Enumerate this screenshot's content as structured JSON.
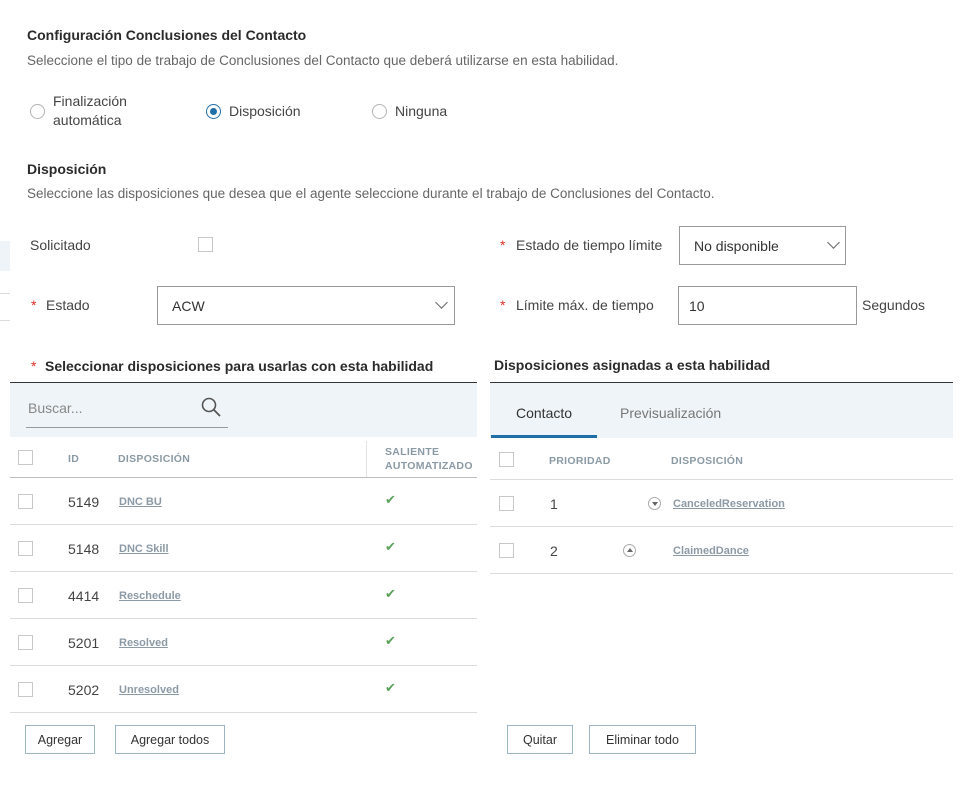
{
  "acw": {
    "title": "Configuración Conclusiones del Contacto",
    "description": "Seleccione el tipo de trabajo de Conclusiones del Contacto que deberá utilizarse en esta habilidad.",
    "options": [
      {
        "line1": "Finalización",
        "line2": "automática",
        "checked": false
      },
      {
        "label": "Disposición",
        "checked": true
      },
      {
        "label": "Ninguna",
        "checked": false
      }
    ]
  },
  "disposition": {
    "title": "Disposición",
    "description": "Seleccione las disposiciones que desea que el agente seleccione durante el trabajo de Conclusiones del Contacto."
  },
  "form": {
    "required_mark": "*",
    "solicitado_label": "Solicitado",
    "timeout_state_label": "Estado de tiempo límite",
    "timeout_state_value": "No disponible",
    "estado_label": "Estado",
    "estado_value": "ACW",
    "max_time_label": "Límite máx. de tiempo",
    "max_time_value": "10",
    "max_time_unit": "Segundos"
  },
  "available": {
    "title": "Seleccionar disposiciones para usarlas con esta habilidad",
    "search_placeholder": "Buscar...",
    "columns": {
      "id": "ID",
      "disposition": "DISPOSICIÓN",
      "outbound_line1": "SALIENTE",
      "outbound_line2": "AUTOMATIZADO"
    },
    "rows": [
      {
        "id": "5149",
        "name": "DNC BU",
        "automated": true
      },
      {
        "id": "5148",
        "name": "DNC Skill",
        "automated": true
      },
      {
        "id": "4414",
        "name": "Reschedule",
        "automated": true
      },
      {
        "id": "5201",
        "name": "Resolved",
        "automated": true
      },
      {
        "id": "5202",
        "name": "Unresolved",
        "automated": true
      }
    ],
    "add_label": "Agregar",
    "add_all_label": "Agregar todos"
  },
  "assigned": {
    "title": "Disposiciones asignadas a esta habilidad",
    "tabs": [
      "Contacto",
      "Previsualización"
    ],
    "active_tab": 0,
    "columns": {
      "priority": "PRIORIDAD",
      "disposition": "DISPOSICIÓN"
    },
    "rows": [
      {
        "priority": "1",
        "name": "CanceledReservation"
      },
      {
        "priority": "2",
        "name": "ClaimedDance"
      }
    ],
    "remove_label": "Quitar",
    "remove_all_label": "Eliminar todo"
  },
  "colors": {
    "accent": "#1f6ea8",
    "required": "#d93025",
    "check": "#5aa25a",
    "panel_bg": "#eef4f8"
  }
}
